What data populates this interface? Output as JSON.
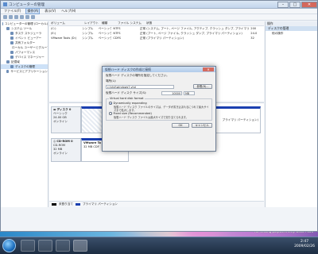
{
  "window": {
    "title": "コンピューターの管理",
    "menu": [
      "ファイル(F)",
      "操作(A)",
      "表示(V)",
      "ヘルプ(H)"
    ],
    "menu_selected_index": 1
  },
  "tree": {
    "items": [
      {
        "label": "コンピューターの管理 (ローカル)",
        "indent": 0
      },
      {
        "label": "システム ツール",
        "indent": 1
      },
      {
        "label": "タスク スケジューラ",
        "indent": 2
      },
      {
        "label": "イベント ビューアー",
        "indent": 2
      },
      {
        "label": "共有フォルダー",
        "indent": 2
      },
      {
        "label": "ローカル ユーザーとグループ",
        "indent": 2
      },
      {
        "label": "パフォーマンス",
        "indent": 2
      },
      {
        "label": "デバイス マネージャー",
        "indent": 2
      },
      {
        "label": "記憶域",
        "indent": 1
      },
      {
        "label": "ディスクの管理",
        "indent": 2,
        "selected": true
      },
      {
        "label": "サービスとアプリケーション",
        "indent": 1
      }
    ]
  },
  "volumes": {
    "headers": [
      "ボリューム",
      "レイアウト",
      "種類",
      "ファイル システム",
      "状態"
    ],
    "rows": [
      [
        "(C:)",
        "シンプル",
        "ベーシック",
        "NTFS",
        "正常 (システム, ブート, ページ ファイル, アクティブ, クラッシュ ダンプ, プライマリ パーティション)"
      ],
      [
        "(E:)",
        "シンプル",
        "ベーシック",
        "NTFS",
        "正常 (ブート, ページ ファイル, クラッシュ ダンプ, プライマリ パーティション)"
      ],
      [
        "VMware Tools (D:)",
        "シンプル",
        "ベーシック",
        "CDFS",
        "正常 (プライマリ パーティション)"
      ]
    ],
    "right_col": [
      "200",
      "24.0",
      "32"
    ]
  },
  "actions": {
    "header": "操作",
    "section": "ディスクの管理",
    "items": [
      "他の操作"
    ]
  },
  "disks": [
    {
      "name": "ディスク 0",
      "type": "ベーシック",
      "size": "24.00 GB",
      "status": "オンライン",
      "part_label": "",
      "part_detail": "プライマリ パーティション)"
    },
    {
      "name": "CD-ROM 0",
      "type": "CD-ROM",
      "size": "32 MB",
      "status": "オンライン",
      "part_label": "VMware To",
      "part_detail": "32 MB CDF"
    }
  ],
  "legend": [
    {
      "label": "未割り当て",
      "color": "#000000"
    },
    {
      "label": "プライマリ パーティション",
      "color": "#1a3fb0"
    }
  ],
  "dialog": {
    "title": "仮想ハード ディスクの作成と接続",
    "intro": "仮想ハード ディスクの場所を指定してください。",
    "location_label": "場所(L):",
    "location_value": "c:\\vhd\\windows7.vhd",
    "browse_label": "参照(B)...",
    "size_label": "仮想ハード ディスク サイズ(S):",
    "size_value": "10000",
    "size_unit": "MB",
    "format_legend": "Virtual hard disk format",
    "options": [
      {
        "label": "Dynamically expanding",
        "selected": true,
        "desc": "仮想ハード ディスク ファイルのサイズは、データが書き込まれるにつれて最大サイズまで拡大します。"
      },
      {
        "label": "Fixed size (Recommended)",
        "selected": false,
        "desc": "仮想ハード ディスク ファイルは最大サイズで割り当てられます。"
      }
    ],
    "ok_label": "OK",
    "cancel_label": "キャンセル"
  },
  "watermark": {
    "line1": "Windows Server 7 Evaluation",
    "line2": "For testing purposes only. Build 7000"
  },
  "taskbar": {
    "time": "2:47",
    "date": "2009/02/26"
  }
}
